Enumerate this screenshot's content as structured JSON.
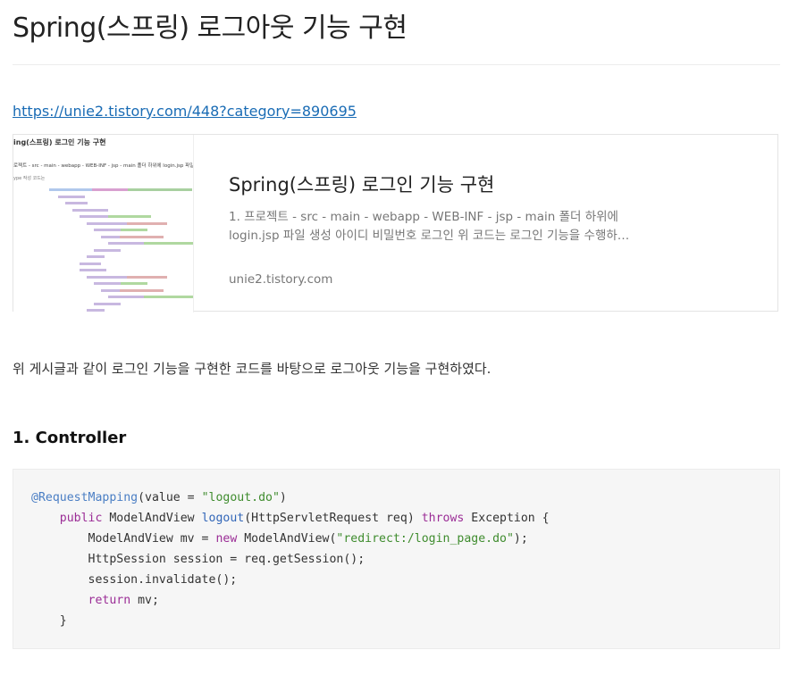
{
  "post": {
    "title": "Spring(스프링) 로그아웃 기능 구현",
    "link": "https://unie2.tistory.com/448?category=890695"
  },
  "og_card": {
    "thumb_title": "ing(스프링) 로그인 기능 구현",
    "thumb_sub": "로젝트 - src - main - webapp - WEB-INF - jsp - main 폴더 하위에 login.jsp 파일 생성",
    "thumb_small": "ype 작성 코드는",
    "title": "Spring(스프링) 로그인 기능 구현",
    "desc_line1": "1. 프로젝트 - src - main - webapp - WEB-INF - jsp - main 폴더 하위에",
    "desc_line2": "login.jsp 파일 생성 아이디 비밀번호 로그인 위 코드는 로그인 기능을 수행하…",
    "domain": "unie2.tistory.com"
  },
  "paragraph": "위 게시글과 같이 로그인 기능을 구현한 코드를 바탕으로 로그아웃 기능을 구현하였다.",
  "section_heading": "1. Controller",
  "code": {
    "l1_annotation": "@RequestMapping",
    "l1_a": "(value = ",
    "l1_str": "\"logout.do\"",
    "l1_b": ")",
    "l2_indent": "    ",
    "l2_kw": "public",
    "l2_a": " ModelAndView ",
    "l2_fn": "logout",
    "l2_b": "(HttpServletRequest req) ",
    "l2_kw2": "throws",
    "l2_c": " Exception {",
    "l3_a": "        ModelAndView mv = ",
    "l3_kw": "new",
    "l3_b": " ModelAndView(",
    "l3_str": "\"redirect:/login_page.do\"",
    "l3_c": ");",
    "l4": "        HttpSession session = req.getSession();",
    "l5": "        session.invalidate();",
    "l6_indent": "        ",
    "l6_kw": "return",
    "l6_a": " mv;",
    "l7": "    }"
  },
  "colors": {
    "link": "#1a6cb5",
    "keyword": "#9b2d96",
    "annotation": "#4a7ec4",
    "string": "#3f8c2e",
    "code_bg": "#f6f6f6"
  }
}
